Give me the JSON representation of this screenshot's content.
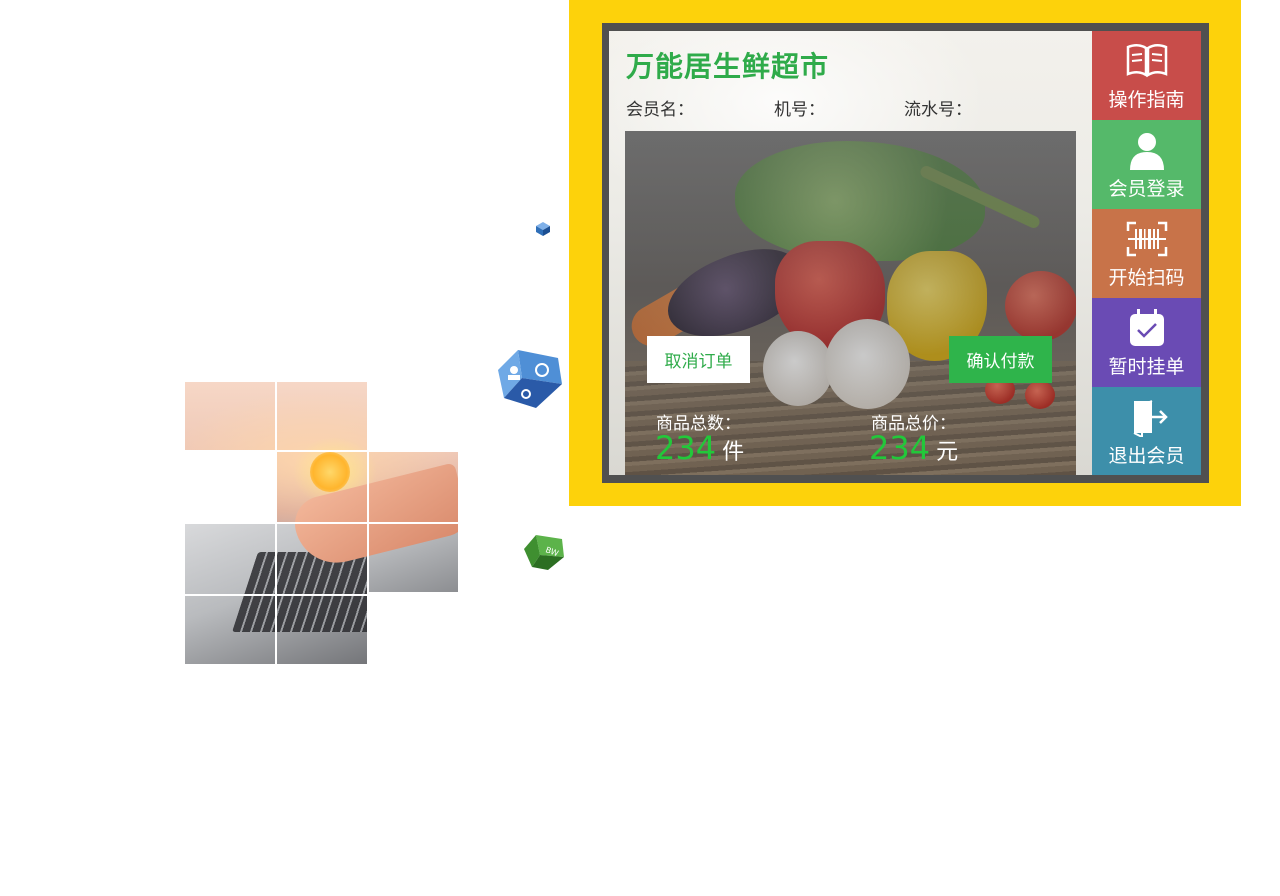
{
  "store": {
    "title": "万能居生鲜超市"
  },
  "info": {
    "member_label": "会员名：",
    "machine_label": "机号：",
    "serial_label": "流水号："
  },
  "order_actions": {
    "cancel_label": "取消订单",
    "confirm_label": "确认付款"
  },
  "totals": {
    "count_label": "商品总数：",
    "count_value": "234",
    "count_unit": "件",
    "price_label": "商品总价：",
    "price_value": "234",
    "price_unit": "元"
  },
  "side_menu": {
    "items": [
      {
        "label": "操作指南",
        "icon": "book-icon",
        "color": "#c84d4a"
      },
      {
        "label": "会员登录",
        "icon": "user-icon",
        "color": "#55b96a"
      },
      {
        "label": "开始扫码",
        "icon": "barcode-scan-icon",
        "color": "#c87349"
      },
      {
        "label": "暂时挂单",
        "icon": "calendar-check-icon",
        "color": "#6a4bb4"
      },
      {
        "label": "退出会员",
        "icon": "exit-door-icon",
        "color": "#3d8faa"
      }
    ]
  },
  "colors": {
    "frame_yellow": "#fdd20b",
    "brand_green": "#2fab4a",
    "bezel_gray": "#505050"
  }
}
